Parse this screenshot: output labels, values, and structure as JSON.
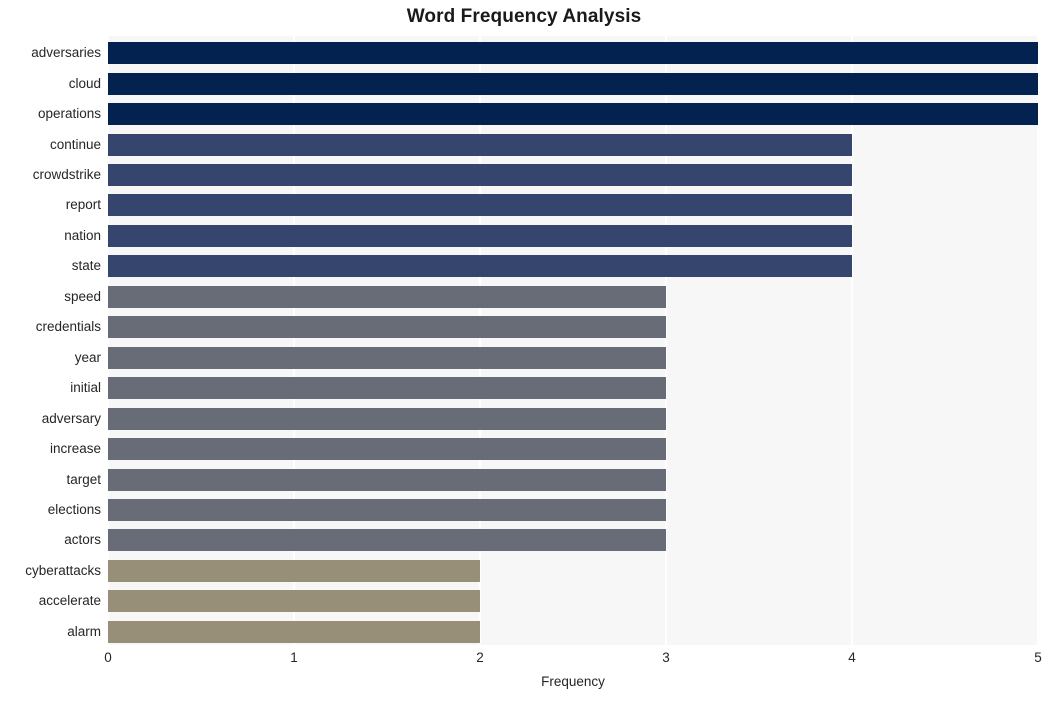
{
  "chart_data": {
    "type": "bar",
    "orientation": "horizontal",
    "title": "Word Frequency Analysis",
    "xlabel": "Frequency",
    "ylabel": "",
    "xlim": [
      0,
      5
    ],
    "xticks": [
      "0",
      "1",
      "2",
      "3",
      "4",
      "5"
    ],
    "grid": "vertical-only",
    "legend": "none",
    "categories": [
      "adversaries",
      "cloud",
      "operations",
      "continue",
      "crowdstrike",
      "report",
      "nation",
      "state",
      "speed",
      "credentials",
      "year",
      "initial",
      "adversary",
      "increase",
      "target",
      "elections",
      "actors",
      "cyberattacks",
      "accelerate",
      "alarm"
    ],
    "values": [
      5,
      5,
      5,
      4,
      4,
      4,
      4,
      4,
      3,
      3,
      3,
      3,
      3,
      3,
      3,
      3,
      3,
      2,
      2,
      2
    ],
    "bar_colors": [
      "#04224f",
      "#04224f",
      "#04224f",
      "#36456e",
      "#36456e",
      "#36456e",
      "#36456e",
      "#36456e",
      "#686c76",
      "#686c76",
      "#686c76",
      "#686c76",
      "#686c76",
      "#686c76",
      "#686c76",
      "#686c76",
      "#686c76",
      "#978f78",
      "#978f78",
      "#978f78"
    ]
  },
  "style": {
    "plot_background": "#f7f7f7",
    "gridline_color": "#ffffff",
    "page_background": "#ffffff",
    "text_color": "#262626",
    "title_color": "#1a1a1a"
  }
}
